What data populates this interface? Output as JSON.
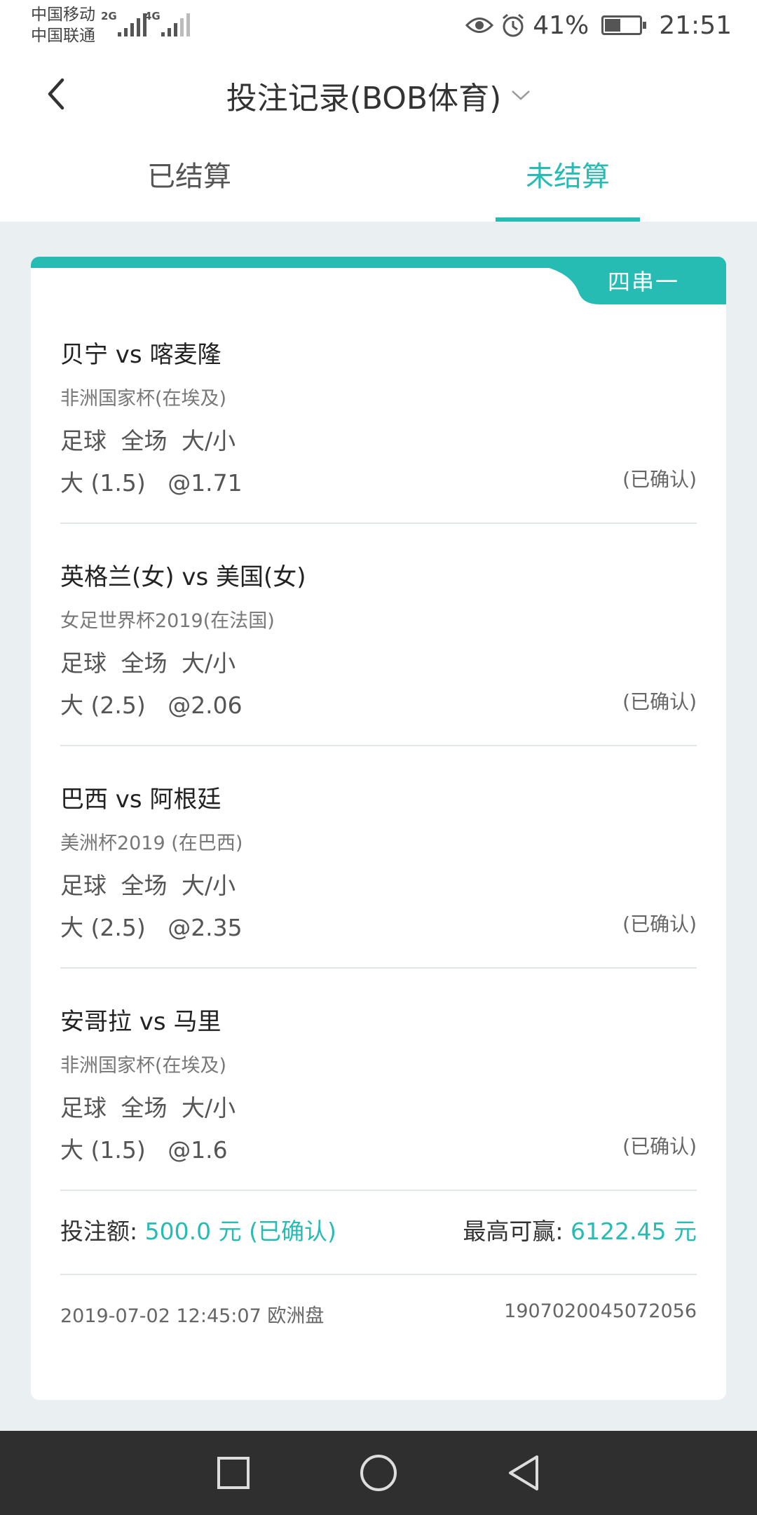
{
  "status_bar": {
    "carrier_1": "中国移动",
    "carrier_2": "中国联通",
    "net_1": "2G",
    "net_2": "4G",
    "battery_percent": "41%",
    "time": "21:51"
  },
  "header": {
    "title": "投注记录(BOB体育)"
  },
  "tabs": [
    {
      "label": "已结算",
      "active": false
    },
    {
      "label": "未结算",
      "active": true
    }
  ],
  "bet": {
    "combo_label": "四串一",
    "legs": [
      {
        "match": "贝宁  vs  喀麦隆",
        "league": "非洲国家杯(在埃及)",
        "type": "足球  全场  大/小",
        "pick": "大 (1.5)   @1.71",
        "status": "(已确认)"
      },
      {
        "match": "英格兰(女) vs 美国(女)",
        "league": "女足世界杯2019(在法国)",
        "type": "足球  全场  大/小",
        "pick": "大 (2.5)   @2.06",
        "status": "(已确认)"
      },
      {
        "match": "巴西 vs 阿根廷",
        "league": "美洲杯2019 (在巴西)",
        "type": "足球  全场  大/小",
        "pick": "大 (2.5)   @2.35",
        "status": "(已确认)"
      },
      {
        "match": "安哥拉 vs 马里",
        "league": "非洲国家杯(在埃及)",
        "type": "足球  全场  大/小",
        "pick": "大 (1.5)   @1.6",
        "status": "(已确认)"
      }
    ],
    "stake_label": "投注额:",
    "stake_value": "500.0 元 (已确认)",
    "maxwin_label": "最高可赢:",
    "maxwin_value": "6122.45 元",
    "datetime_odds": "2019-07-02 12:45:07 欧洲盘",
    "order_id": "1907020045072056"
  },
  "colors": {
    "accent": "#26bcb4",
    "background": "#eaf0f1",
    "navbar": "#2f2f2f"
  },
  "icons": {
    "back": "back-arrow-icon",
    "dropdown": "chevron-down-icon",
    "eye": "eye-icon",
    "alarm": "alarm-icon",
    "battery": "battery-charging-icon",
    "nav_recent": "square-icon",
    "nav_home": "circle-icon",
    "nav_back": "triangle-back-icon"
  }
}
